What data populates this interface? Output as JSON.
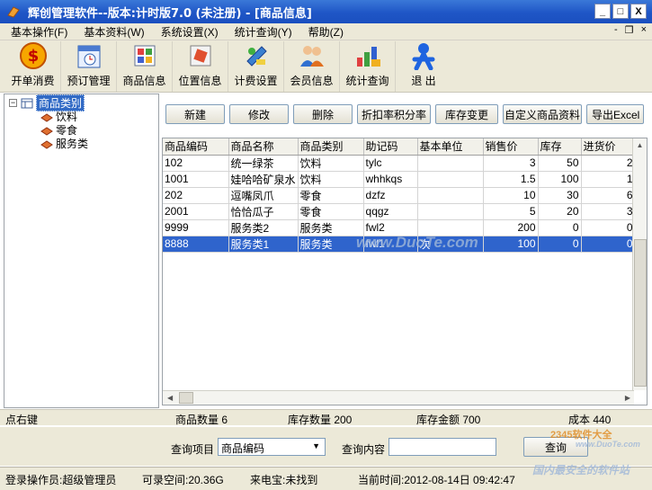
{
  "window": {
    "title": "辉创管理软件--版本:计时版7.0 (未注册) - [商品信息]",
    "min_glyph": "_",
    "max_glyph": "□",
    "close_glyph": "X"
  },
  "menu": [
    {
      "label": "基本操作(F)"
    },
    {
      "label": "基本资料(W)"
    },
    {
      "label": "系统设置(X)"
    },
    {
      "label": "统计查询(Y)"
    },
    {
      "label": "帮助(Z)"
    }
  ],
  "mdi": {
    "min": "-",
    "restore": "❐",
    "close": "×"
  },
  "toolbar": [
    {
      "label": "开单消费",
      "icon": "coin-icon"
    },
    {
      "label": "预订管理",
      "icon": "calendar-icon"
    },
    {
      "label": "商品信息",
      "icon": "products-icon"
    },
    {
      "label": "位置信息",
      "icon": "location-icon"
    },
    {
      "label": "计费设置",
      "icon": "billing-icon"
    },
    {
      "label": "会员信息",
      "icon": "members-icon"
    },
    {
      "label": "统计查询",
      "icon": "statistics-icon"
    },
    {
      "label": "退 出",
      "icon": "exit-icon"
    }
  ],
  "tree": {
    "root": "商品类别",
    "expander": "−",
    "children": [
      "饮料",
      "零食",
      "服务类"
    ]
  },
  "actions": {
    "new": "新建",
    "edit": "修改",
    "delete": "删除",
    "discount": "折扣率积分率",
    "stock": "库存变更",
    "custom": "自定义商品资料",
    "export": "导出Excel"
  },
  "grid": {
    "columns": [
      "商品编码",
      "商品名称",
      "商品类别",
      "助记码",
      "基本单位",
      "销售价",
      "库存",
      "进货价"
    ],
    "rows": [
      [
        "102",
        "统一绿茶",
        "饮料",
        "tylc",
        "",
        "3",
        "50",
        "2"
      ],
      [
        "1001",
        "娃哈哈矿泉水",
        "饮料",
        "whhkqs",
        "",
        "1.5",
        "100",
        "1"
      ],
      [
        "202",
        "逗嘴凤爪",
        "零食",
        "dzfz",
        "",
        "10",
        "30",
        "6"
      ],
      [
        "2001",
        "恰恰瓜子",
        "零食",
        "qqgz",
        "",
        "5",
        "20",
        "3"
      ],
      [
        "9999",
        "服务类2",
        "服务类",
        "fwl2",
        "",
        "200",
        "0",
        "0"
      ],
      [
        "8888",
        "服务类1",
        "服务类",
        "fwl1",
        "次",
        "100",
        "0",
        "0"
      ]
    ],
    "selected_row": 5
  },
  "status": {
    "hint": "点右键",
    "count": "商品数量 6",
    "stock": "库存数量 200",
    "amount": "库存金额 700",
    "cost": "成本 440"
  },
  "query": {
    "item_label": "查询项目",
    "item_value": "商品编码",
    "content_label": "查询内容",
    "content_value": "",
    "button": "查询"
  },
  "footer": {
    "operator": "登录操作员:超级管理员",
    "space": "可录空间:20.36G",
    "caller": "来电宝:未找到",
    "time": "当前时间:2012-08-14日 09:42:47"
  },
  "watermarks": {
    "grid": "www.DuoTe.com",
    "brand": "2345软件大全",
    "site": "www.DuoTe.com",
    "slogan": "国内最安全的软件站"
  },
  "colors": {
    "title_bar": "#1f56c6",
    "selection": "#2f64cc",
    "chrome": "#ece9d8"
  }
}
